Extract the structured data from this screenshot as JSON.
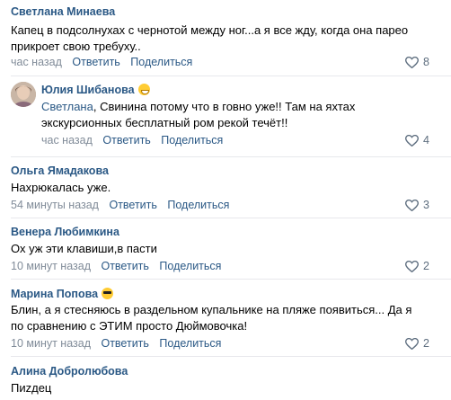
{
  "comments": [
    {
      "author": "Светлана Минаева",
      "text_lines": [
        "Капец в подсолнухах с чернотой между ног...а я все жду, когда она парео",
        "прикроет свою требуху.."
      ],
      "time": "час назад",
      "reply_label": "Ответить",
      "share_label": "Поделиться",
      "likes": "8"
    },
    {
      "author": "Юлия Шибанова",
      "author_emoji": "grinning-face-emoji",
      "mention": "Светлана",
      "text_first_rest": ", Свинина потому что в говно уже!! Там на яхтах",
      "text_second": "экскурсионных бесплатный ром рекой течёт!!",
      "time": "час назад",
      "reply_label": "Ответить",
      "share_label": "Поделиться",
      "likes": "4"
    },
    {
      "author": "Ольга Ямадакова",
      "text_lines": [
        "Нахрюкалась уже."
      ],
      "time": "54 минуты назад",
      "reply_label": "Ответить",
      "share_label": "Поделиться",
      "likes": "3"
    },
    {
      "author": "Венера Любимкина",
      "text_lines": [
        "Ох уж эти клавиши,в пасти"
      ],
      "time": "10 минут назад",
      "reply_label": "Ответить",
      "share_label": "Поделиться",
      "likes": "2"
    },
    {
      "author": "Марина Попова",
      "author_emoji": "sunglasses-face-emoji",
      "text_lines": [
        "Блин, а я стесняюсь в раздельном купальнике на пляже появиться... Да я",
        "по сравнению с ЭТИМ просто Дюймовочка!"
      ],
      "time": "10 минут назад",
      "reply_label": "Ответить",
      "share_label": "Поделиться",
      "likes": "2"
    },
    {
      "author": "Алина Добролюбова",
      "text_lines": [
        "Пиzдец"
      ]
    }
  ],
  "icons": {
    "like": "heart-outline-icon"
  },
  "colors": {
    "link": "#2a5885",
    "meta": "#818c99",
    "divider": "#e7e8ec"
  }
}
